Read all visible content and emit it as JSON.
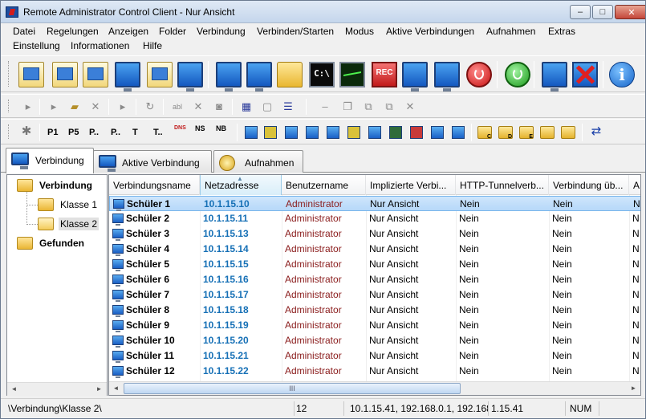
{
  "window": {
    "title": "Remote Administrator Control Client - Nur Ansicht",
    "minimize_glyph": "–",
    "maximize_glyph": "□",
    "close_glyph": "✕"
  },
  "menu": {
    "row1": [
      "Datei",
      "Regelungen",
      "Anzeigen",
      "Folder",
      "Verbindung",
      "Verbinden/Starten",
      "Modus",
      "Aktive Verbindungen",
      "Aufnahmen",
      "Extras"
    ],
    "row2": [
      "Einstellung",
      "Informationen",
      "Hilfe"
    ]
  },
  "toolbar1": {
    "cmd_label": "C:\\",
    "rec_label": "REC",
    "info_label": "i"
  },
  "toolbar3": {
    "p1": "P1",
    "p5": "P5",
    "pdots": "P..",
    "pdots2": "P..",
    "t": "T",
    "tdots": "T..",
    "dns": "DNS",
    "ns": "NS",
    "nb": "NB",
    "fold_c": "C",
    "fold_d": "D",
    "fold_e": "E"
  },
  "tabs": [
    {
      "label": "Verbindung"
    },
    {
      "label": "Aktive Verbindung"
    },
    {
      "label": "Aufnahmen"
    }
  ],
  "tree": {
    "root": "Verbindung",
    "children": [
      "Klasse 1",
      "Klasse 2"
    ],
    "found": "Gefunden",
    "selected": "Klasse 2"
  },
  "list": {
    "columns": [
      "Verbindungsname",
      "Netzadresse",
      "Benutzername",
      "Implizierte Verbi...",
      "HTTP-Tunnelverb...",
      "Verbindung üb...",
      "A"
    ],
    "sorted_column": "Netzadresse",
    "rows": [
      {
        "name": "Schüler 1",
        "ip": "10.1.15.10",
        "user": "Administrator",
        "implicit": "Nur Ansicht",
        "http": "Nein",
        "via": "Nein",
        "a": "N"
      },
      {
        "name": "Schüler 2",
        "ip": "10.1.15.11",
        "user": "Administrator",
        "implicit": "Nur Ansicht",
        "http": "Nein",
        "via": "Nein",
        "a": "N"
      },
      {
        "name": "Schüler 3",
        "ip": "10.1.15.13",
        "user": "Administrator",
        "implicit": "Nur Ansicht",
        "http": "Nein",
        "via": "Nein",
        "a": "N"
      },
      {
        "name": "Schüler 4",
        "ip": "10.1.15.14",
        "user": "Administrator",
        "implicit": "Nur Ansicht",
        "http": "Nein",
        "via": "Nein",
        "a": "N"
      },
      {
        "name": "Schüler 5",
        "ip": "10.1.15.15",
        "user": "Administrator",
        "implicit": "Nur Ansicht",
        "http": "Nein",
        "via": "Nein",
        "a": "N"
      },
      {
        "name": "Schüler 6",
        "ip": "10.1.15.16",
        "user": "Administrator",
        "implicit": "Nur Ansicht",
        "http": "Nein",
        "via": "Nein",
        "a": "N"
      },
      {
        "name": "Schüler 7",
        "ip": "10.1.15.17",
        "user": "Administrator",
        "implicit": "Nur Ansicht",
        "http": "Nein",
        "via": "Nein",
        "a": "N"
      },
      {
        "name": "Schüler 8",
        "ip": "10.1.15.18",
        "user": "Administrator",
        "implicit": "Nur Ansicht",
        "http": "Nein",
        "via": "Nein",
        "a": "N"
      },
      {
        "name": "Schüler 9",
        "ip": "10.1.15.19",
        "user": "Administrator",
        "implicit": "Nur Ansicht",
        "http": "Nein",
        "via": "Nein",
        "a": "N"
      },
      {
        "name": "Schüler 10",
        "ip": "10.1.15.20",
        "user": "Administrator",
        "implicit": "Nur Ansicht",
        "http": "Nein",
        "via": "Nein",
        "a": "N"
      },
      {
        "name": "Schüler 11",
        "ip": "10.1.15.21",
        "user": "Administrator",
        "implicit": "Nur Ansicht",
        "http": "Nein",
        "via": "Nein",
        "a": "N"
      },
      {
        "name": "Schüler 12",
        "ip": "10.1.15.22",
        "user": "Administrator",
        "implicit": "Nur Ansicht",
        "http": "Nein",
        "via": "Nein",
        "a": "N"
      }
    ],
    "selected_row": 0
  },
  "scroll": {
    "left": "◄",
    "right": "►",
    "thumb": "III"
  },
  "status": {
    "path": "\\Verbindung\\Klasse 2\\",
    "count": "12",
    "addresses": "10.1.15.41, 192.168.0.1, 192.168.15",
    "ip": "1.15.41",
    "num": "NUM"
  },
  "colors": {
    "ip_text": "#1670b6",
    "user_text": "#8a1c1c",
    "selection": "#b6d8f9"
  }
}
